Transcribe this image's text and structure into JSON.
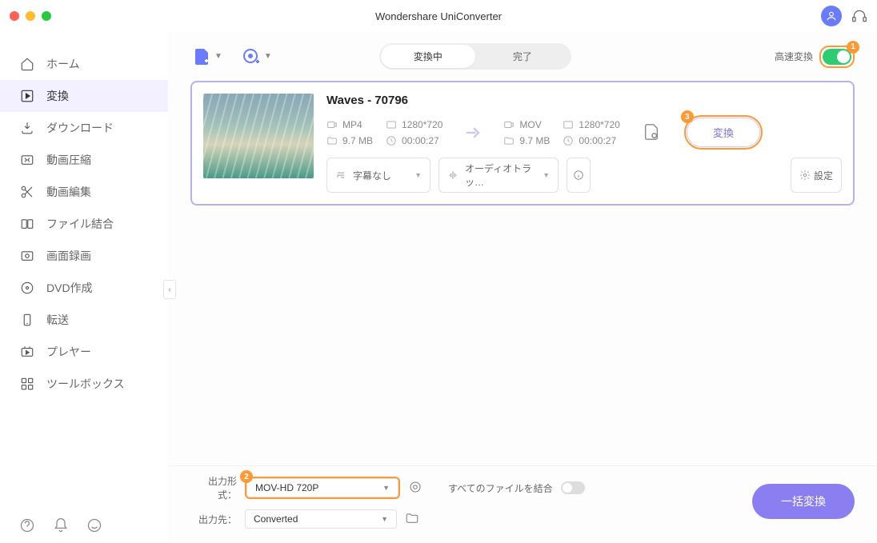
{
  "app": {
    "title": "Wondershare UniConverter"
  },
  "sidebar": {
    "items": [
      {
        "label": "ホーム"
      },
      {
        "label": "変換"
      },
      {
        "label": "ダウンロード"
      },
      {
        "label": "動画圧縮"
      },
      {
        "label": "動画編集"
      },
      {
        "label": "ファイル結合"
      },
      {
        "label": "画面録画"
      },
      {
        "label": "DVD作成"
      },
      {
        "label": "転送"
      },
      {
        "label": "プレヤー"
      },
      {
        "label": "ツールボックス"
      }
    ]
  },
  "toolbar": {
    "tabs": {
      "converting": "変換中",
      "done": "完了"
    },
    "fast_label": "高速変換"
  },
  "file": {
    "title": "Waves - 70796",
    "src": {
      "fmt": "MP4",
      "res": "1280*720",
      "size": "9.7 MB",
      "dur": "00:00:27"
    },
    "dst": {
      "fmt": "MOV",
      "res": "1280*720",
      "size": "9.7 MB",
      "dur": "00:00:27"
    },
    "convert_btn": "変換",
    "subtitle": "字幕なし",
    "audio": "オーディオトラッ…",
    "settings_btn": "設定"
  },
  "bottom": {
    "output_format_label": "出力形式：",
    "output_format_value": "MOV-HD 720P",
    "output_dir_label": "出力先：",
    "output_dir_value": "Converted",
    "merge_label": "すべてのファイルを結合",
    "batch_btn": "一括変換"
  },
  "badges": {
    "b1": "1",
    "b2": "2",
    "b3": "3"
  }
}
